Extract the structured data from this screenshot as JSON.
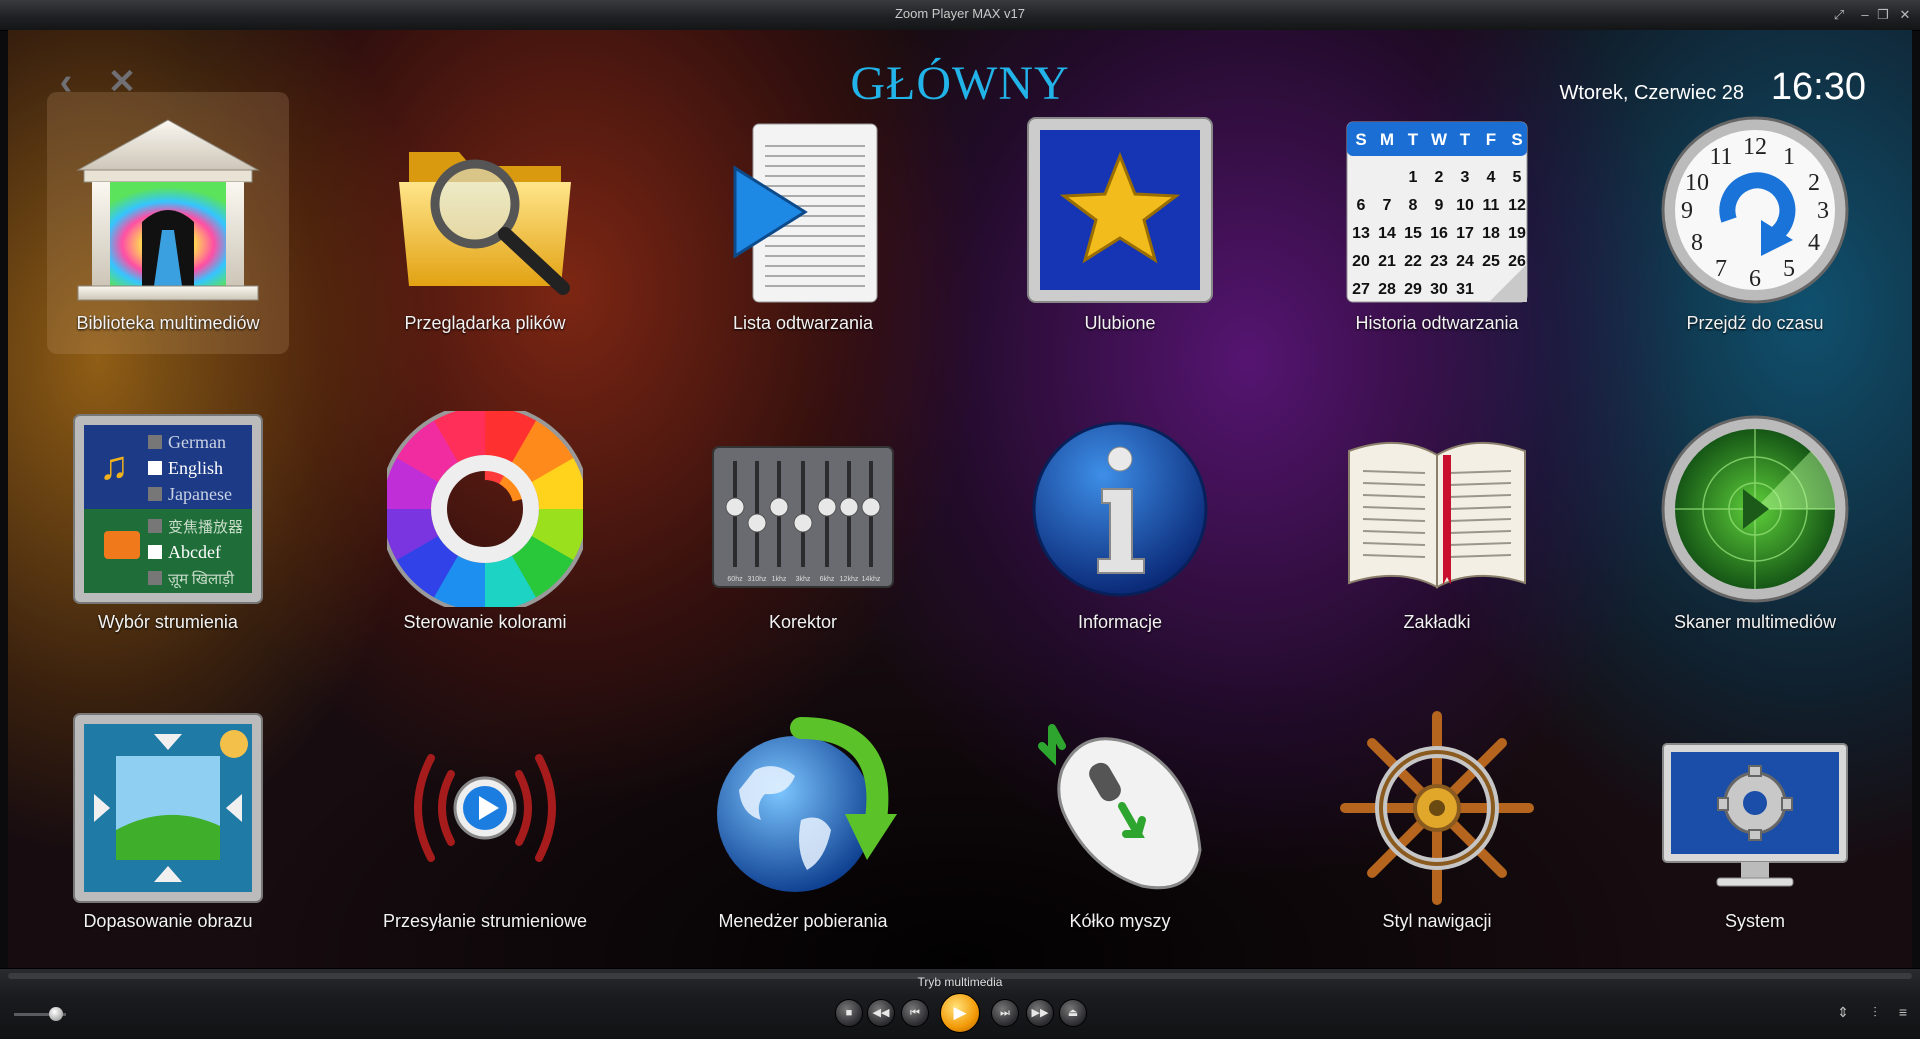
{
  "window": {
    "title": "Zoom Player MAX v17",
    "controls": {
      "fullscreen": "⤢",
      "minimize": "–",
      "restore": "❐",
      "close": "✕"
    }
  },
  "header": {
    "back_icon": "‹",
    "close_icon": "✕",
    "title": "GŁÓWNY",
    "date": "Wtorek, Czerwiec 28",
    "time": "16:30"
  },
  "colors": {
    "title_accent": "#22b3e8",
    "play_button": "#f39a07"
  },
  "tiles": [
    {
      "label": "Biblioteka multimediów",
      "icon": "library-icon",
      "selected": true
    },
    {
      "label": "Przeglądarka plików",
      "icon": "folder-search-icon"
    },
    {
      "label": "Lista odtwarzania",
      "icon": "playlist-icon"
    },
    {
      "label": "Ulubione",
      "icon": "star-icon"
    },
    {
      "label": "Historia odtwarzania",
      "icon": "calendar-icon"
    },
    {
      "label": "Przejdź do czasu",
      "icon": "clock-icon"
    },
    {
      "label": "Wybór strumienia",
      "icon": "stream-language-icon"
    },
    {
      "label": "Sterowanie kolorami",
      "icon": "color-wheel-icon"
    },
    {
      "label": "Korektor",
      "icon": "equalizer-icon"
    },
    {
      "label": "Informacje",
      "icon": "info-icon"
    },
    {
      "label": "Zakładki",
      "icon": "book-icon"
    },
    {
      "label": "Skaner multimediów",
      "icon": "radar-icon"
    },
    {
      "label": "Dopasowanie obrazu",
      "icon": "image-fit-icon"
    },
    {
      "label": "Przesyłanie strumieniowe",
      "icon": "streaming-icon"
    },
    {
      "label": "Menedżer pobierania",
      "icon": "globe-download-icon"
    },
    {
      "label": "Kółko myszy",
      "icon": "mouse-icon"
    },
    {
      "label": "Styl nawigacji",
      "icon": "ship-wheel-icon"
    },
    {
      "label": "System",
      "icon": "monitor-gear-icon"
    }
  ],
  "icon_text": {
    "calendar_weekdays": [
      "S",
      "M",
      "T",
      "W",
      "T",
      "F",
      "S"
    ],
    "calendar_rows": [
      [
        "",
        "",
        "",
        "1",
        "2",
        "3",
        "4",
        "5"
      ],
      [
        "6",
        "7",
        "8",
        "9",
        "10",
        "11",
        "12"
      ],
      [
        "13",
        "14",
        "15",
        "16",
        "17",
        "18",
        "19"
      ],
      [
        "20",
        "21",
        "22",
        "23",
        "24",
        "25",
        "26"
      ],
      [
        "27",
        "28",
        "29",
        "30",
        "31"
      ]
    ],
    "stream_languages": [
      "German",
      "English",
      "Japanese"
    ],
    "stream_subtitles": [
      "变焦播放器",
      "Abcdef",
      "ज़ूम खिलाड़ी"
    ],
    "equalizer_bands": [
      "60hz",
      "310hz",
      "1khz",
      "3khz",
      "6khz",
      "12khz",
      "14khz"
    ],
    "clock_numbers": [
      "12",
      "1",
      "2",
      "3",
      "4",
      "5",
      "6",
      "7",
      "8",
      "9",
      "10",
      "11"
    ]
  },
  "player": {
    "mode_label": "Tryb multimedia",
    "volume_level": 0.8,
    "buttons": {
      "stop": "■",
      "rewind": "◀◀",
      "previous": "⏮",
      "play": "▶",
      "next": "⏭",
      "forward": "▶▶",
      "open": "⏏"
    },
    "right_controls": {
      "updown": "⇕",
      "equalizer": "⫶",
      "settings": "≡"
    }
  }
}
